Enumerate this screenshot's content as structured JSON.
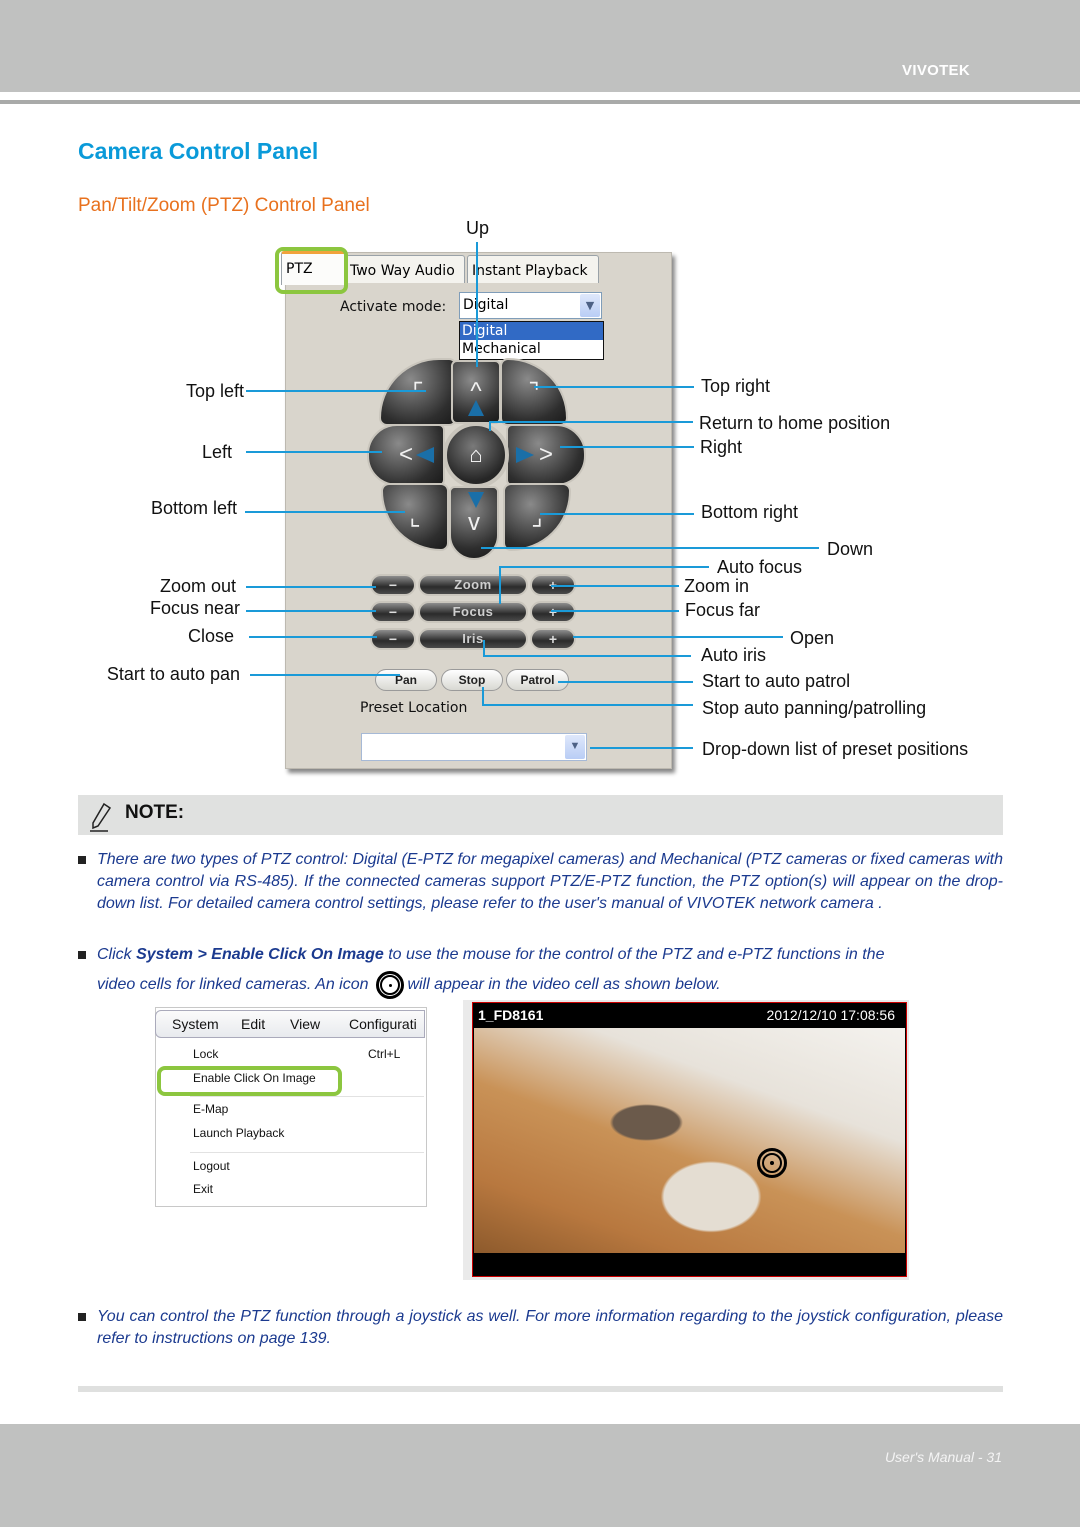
{
  "header": {
    "brand": "VIVOTEK"
  },
  "page": {
    "title": "Camera Control Panel",
    "subtitle": "Pan/Tilt/Zoom (PTZ) Control Panel"
  },
  "panel": {
    "tabs": [
      {
        "label": "PTZ",
        "active": true
      },
      {
        "label": "Two Way Audio",
        "active": false
      },
      {
        "label": "Instant Playback",
        "active": false
      }
    ],
    "activate_mode_label": "Activate mode:",
    "activate_mode_value": "Digital",
    "activate_mode_options": [
      "Digital",
      "Mechanical"
    ],
    "activate_mode_highlighted": "Digital",
    "dpad_glyphs": {
      "up": "^",
      "down": "v",
      "left": "<",
      "right": ">",
      "top_left": "⌜",
      "top_right": "⌝",
      "bottom_left": "⌞",
      "bottom_right": "⌟",
      "home": "⌂"
    },
    "rows": [
      {
        "minus": "−",
        "label": "Zoom",
        "plus": "+"
      },
      {
        "minus": "−",
        "label": "Focus",
        "plus": "+"
      },
      {
        "minus": "−",
        "label": "Iris",
        "plus": "+"
      }
    ],
    "buttons": {
      "pan": "Pan",
      "stop": "Stop",
      "patrol": "Patrol"
    },
    "preset_label": "Preset Location",
    "preset_value": "",
    "dropdown_arrow": "⌄"
  },
  "callouts": {
    "up": "Up",
    "top_left": "Top left",
    "left": "Left",
    "bottom_left": "Bottom left",
    "zoom_out": "Zoom out",
    "focus_near": "Focus near",
    "close": "Close",
    "start_auto_pan": "Start to auto pan",
    "top_right": "Top right",
    "home": "Return to home position",
    "right": "Right",
    "bottom_right": "Bottom right",
    "down": "Down",
    "auto_focus": "Auto focus",
    "zoom_in": "Zoom in",
    "focus_far": "Focus far",
    "open": "Open",
    "auto_iris": "Auto iris",
    "start_auto_patrol": "Start to auto patrol",
    "stop_auto": "Stop auto panning/patrolling",
    "preset_dropdown": "Drop-down list of preset positions"
  },
  "note": {
    "title": "NOTE:",
    "icon": "pencil-icon",
    "bullets": [
      "There are two types of PTZ control: Digital (E-PTZ for megapixel cameras) and Mechanical (PTZ cameras or fixed cameras with camera control via RS-485). If the connected cameras support PTZ/E-PTZ function, the PTZ option(s) will appear on the drop-down list. For detailed camera control settings, please refer to the user's manual of VIVOTEK network camera ."
    ],
    "bullet2": {
      "prefix": "Click ",
      "bold": "System > Enable Click On Image",
      "suffix": " to use the mouse for the control of the PTZ and e-PTZ functions in the",
      "line2_a": "video cells for linked cameras. An icon",
      "line2_b": "will appear in the video cell as shown below."
    },
    "bullet3": "You can control the PTZ function through a joystick as well. For more information regarding to the joystick configuration, please refer to instructions on page 139."
  },
  "system_menu": {
    "menubar": [
      "System",
      "Edit",
      "View",
      "Configurati"
    ],
    "items": [
      {
        "label": "Lock",
        "shortcut": "Ctrl+L"
      },
      {
        "label": "Enable Click On Image",
        "shortcut": ""
      },
      {
        "label": "E-Map",
        "shortcut": ""
      },
      {
        "label": "Launch Playback",
        "shortcut": ""
      },
      {
        "label": "Logout",
        "shortcut": ""
      },
      {
        "label": "Exit",
        "shortcut": ""
      }
    ]
  },
  "video_cell": {
    "camera_name": "1_FD8161",
    "timestamp": "2012/12/10  17:08:56"
  },
  "footer": {
    "text": "User's Manual - 31"
  },
  "colors": {
    "title_blue": "#0a9ad9",
    "subtitle_orange": "#e8711e",
    "callout_line": "#1a9ad8",
    "highlight_green": "#8cc63f",
    "note_text": "#1b3a8f",
    "header_gray": "#c0c1c0"
  }
}
